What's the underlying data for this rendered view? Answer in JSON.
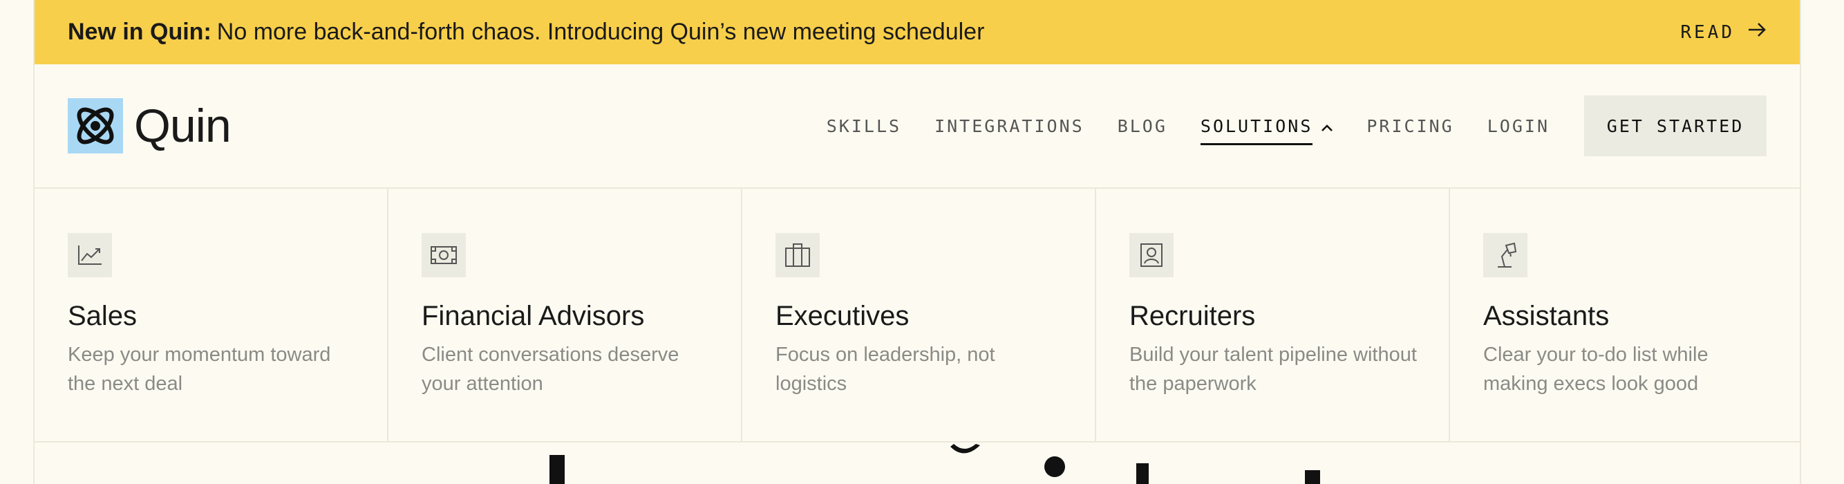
{
  "banner": {
    "bold": "New in Quin:",
    "text": "No more back-and-forth chaos. Introducing Quin’s new meeting scheduler",
    "read_label": "READ"
  },
  "brand": {
    "name": "Quin",
    "logo_icon": "orbit-logo-icon"
  },
  "nav": {
    "skills": "SKILLS",
    "integrations": "INTEGRATIONS",
    "blog": "BLOG",
    "solutions": "SOLUTIONS",
    "pricing": "PRICING",
    "login": "LOGIN",
    "cta": "GET STARTED"
  },
  "solutions_menu": [
    {
      "icon": "trend-chart-icon",
      "title": "Sales",
      "desc": "Keep your momentum toward the next deal"
    },
    {
      "icon": "banknote-icon",
      "title": "Financial Advisors",
      "desc": "Client conversations deserve your attention"
    },
    {
      "icon": "briefcase-icon",
      "title": "Executives",
      "desc": "Focus on leadership, not logistics"
    },
    {
      "icon": "id-badge-icon",
      "title": "Recruiters",
      "desc": "Build your talent pipeline without the paperwork"
    },
    {
      "icon": "desk-lamp-icon",
      "title": "Assistants",
      "desc": "Clear your to-do list while making execs look good"
    }
  ],
  "colors": {
    "banner": "#f8cf4a",
    "background": "#fdfbf1",
    "logo_bg": "#a9d8f4",
    "cta_bg": "#ecebe1"
  }
}
